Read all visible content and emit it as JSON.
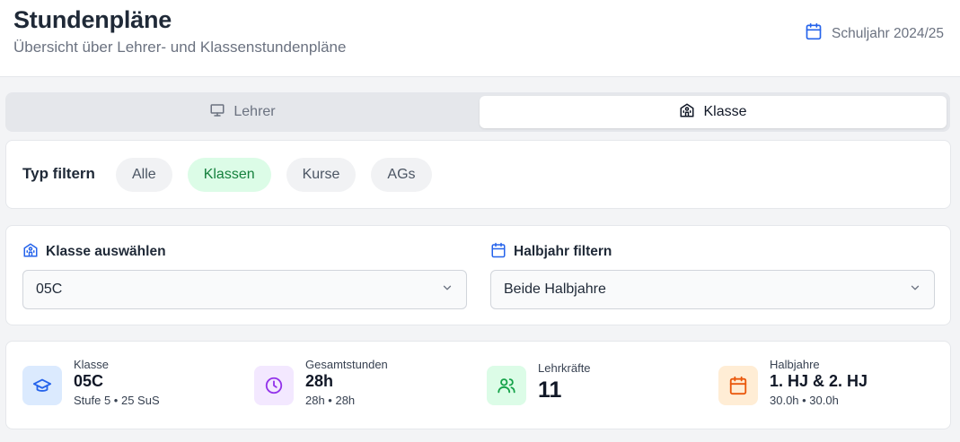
{
  "header": {
    "title": "Stundenpläne",
    "subtitle": "Übersicht über Lehrer- und Klassenstundenpläne",
    "schoolyear": "Schuljahr 2024/25",
    "schoolyear_icon": "calendar-icon"
  },
  "tabs": [
    {
      "label": "Lehrer",
      "icon": "presentation-icon",
      "active": false
    },
    {
      "label": "Klasse",
      "icon": "school-icon",
      "active": true
    }
  ],
  "filter": {
    "label": "Typ filtern",
    "chips": [
      {
        "label": "Alle",
        "active": false
      },
      {
        "label": "Klassen",
        "active": true
      },
      {
        "label": "Kurse",
        "active": false
      },
      {
        "label": "AGs",
        "active": false
      }
    ]
  },
  "selects": {
    "class": {
      "label": "Klasse auswählen",
      "value": "05C",
      "icon": "school-icon"
    },
    "halfyear": {
      "label": "Halbjahr filtern",
      "value": "Beide Halbjahre",
      "icon": "calendar-icon"
    }
  },
  "stats": [
    {
      "label": "Klasse",
      "value": "05C",
      "sub": "Stufe 5 • 25 SuS",
      "icon": "graduation-cap-icon",
      "bg": "#dbeafe",
      "color": "#2563eb"
    },
    {
      "label": "Gesamtstunden",
      "value": "28h",
      "sub": "28h • 28h",
      "icon": "clock-icon",
      "bg": "#f3e8ff",
      "color": "#9333ea"
    },
    {
      "label": "Lehrkräfte",
      "value": "11",
      "sub": "",
      "icon": "users-icon",
      "bg": "#dcfce7",
      "color": "#16a34a"
    },
    {
      "label": "Halbjahre",
      "value": "1. HJ & 2. HJ",
      "sub": "30.0h • 30.0h",
      "icon": "calendar-icon",
      "bg": "#ffedd5",
      "color": "#ea580c"
    }
  ],
  "colors": {
    "accent_blue": "#2563eb",
    "active_chip_bg": "#dcfce7",
    "active_chip_text": "#15803d"
  }
}
